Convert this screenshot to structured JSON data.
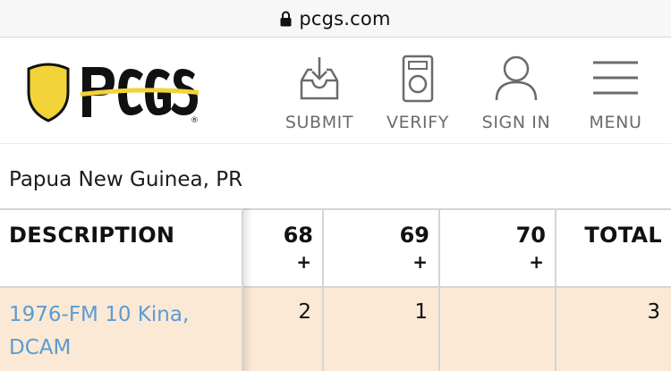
{
  "browser": {
    "url": "pcgs.com"
  },
  "header": {
    "logo_text": "PCGS",
    "nav": [
      {
        "label": "SUBMIT",
        "icon": "inbox-download-icon"
      },
      {
        "label": "VERIFY",
        "icon": "verify-device-icon"
      },
      {
        "label": "SIGN IN",
        "icon": "user-icon"
      },
      {
        "label": "MENU",
        "icon": "hamburger-menu-icon"
      }
    ]
  },
  "page": {
    "title": "Papua New Guinea, PR"
  },
  "table": {
    "columns": {
      "description": "DESCRIPTION",
      "g68": "68",
      "g69": "69",
      "g70": "70",
      "plus": "+",
      "total": "TOTAL"
    },
    "rows": [
      {
        "description": "1976-FM 10 Kina, DCAM",
        "g68": "2",
        "g69": "1",
        "g70": "",
        "total": "3"
      }
    ]
  },
  "colors": {
    "link": "#5b9bd5",
    "row_highlight": "#fbe9d5",
    "shield_gold": "#f2d338",
    "nav_icon": "#6b6b6b"
  }
}
